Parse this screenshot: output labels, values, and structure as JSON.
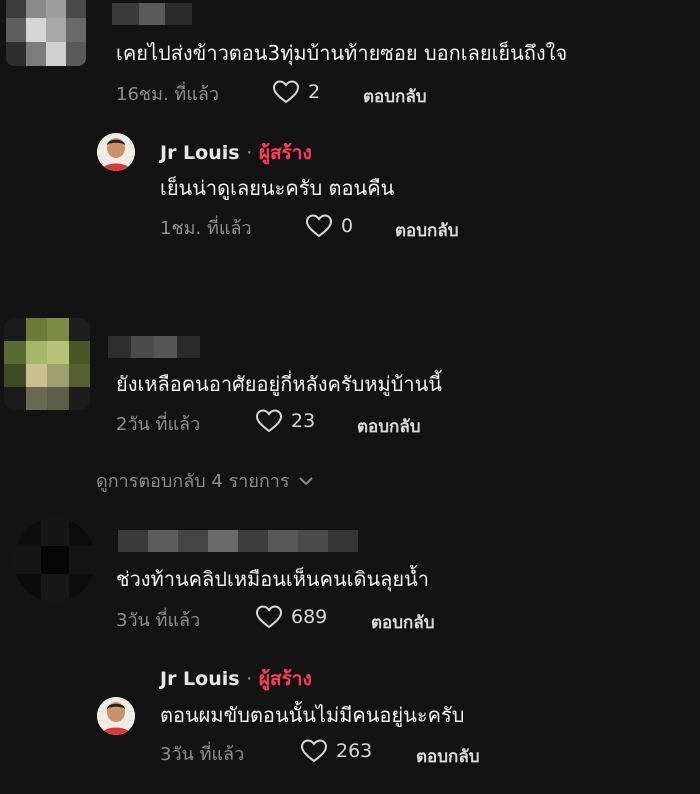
{
  "comments": [
    {
      "text": "เคยไปส่งข้าวตอน3ทุ่มบ้านท้ายซอย บอกเลยเย็นถึงใจ",
      "time": "16ชม. ที่แล้ว",
      "likes": "2",
      "reply_label": "ตอบกลับ",
      "reply": {
        "author": "Jr Louis",
        "separator": "·",
        "badge": "ผู้สร้าง",
        "text": "เย็นน่าดูเลยนะครับ ตอนคืน",
        "time": "1ชม. ที่แล้ว",
        "likes": "0",
        "reply_label": "ตอบกลับ"
      }
    },
    {
      "text": "ยังเหลือคนอาศัยอยู่กี่หลังครับหมู่บ้านนี้",
      "time": "2วัน ที่แล้ว",
      "likes": "23",
      "reply_label": "ตอบกลับ",
      "view_replies": "ดูการตอบกลับ 4 รายการ"
    },
    {
      "text": "ช่วงท้านคลิปเหมือนเห็นคนเดินลุยน้ำ",
      "time": "3วัน ที่แล้ว",
      "likes": "689",
      "reply_label": "ตอบกลับ",
      "reply": {
        "author": "Jr Louis",
        "separator": "·",
        "badge": "ผู้สร้าง",
        "text": "ตอนผมขับตอนนั้นไม่มีคนอยู่นะครับ",
        "time": "3วัน ที่แล้ว",
        "likes": "263",
        "reply_label": "ตอบกลับ"
      }
    }
  ],
  "icons": {
    "like": "heart-outline-icon",
    "expand": "chevron-down-icon"
  },
  "colors": {
    "background": "#131313",
    "creator_badge": "#ff3b5c",
    "meta_text": "#8e8e8e"
  }
}
